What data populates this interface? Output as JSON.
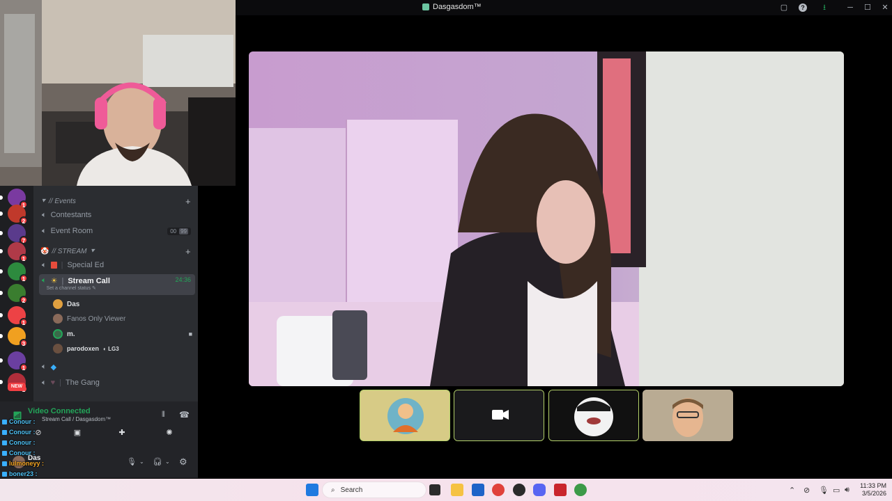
{
  "window": {
    "title": "Dasgasdom™"
  },
  "servers": [
    {
      "badge": "1",
      "color": "#7a3aa0"
    },
    {
      "badge": "2",
      "color": "#c0392b"
    },
    {
      "badge": "7",
      "color": "#5a3b8c"
    },
    {
      "badge": "1",
      "color": "#b03a48"
    },
    {
      "badge": "1",
      "color": "#2d8a3e"
    },
    {
      "badge": "2",
      "color": "#3a7d2f"
    },
    {
      "badge": "1",
      "color": "#ed4245"
    },
    {
      "badge": "3",
      "color": "#f0a020"
    },
    {
      "badge": "1",
      "color": "#6b3fa0"
    },
    {
      "badge": "1",
      "color": "#b02e3a"
    },
    {
      "badge": "NEW",
      "color": "#2b2d31"
    }
  ],
  "channels": {
    "category_events": "// Events",
    "contestants": "Contestants",
    "event_room": "Event Room",
    "event_room_count_a": "00",
    "event_room_count_b": "99",
    "category_stream": "// STREAM",
    "special_ed": "Special Ed",
    "stream_call": "Stream Call",
    "stream_call_timer": "24:36",
    "stream_call_status": "Set a channel status",
    "users": [
      {
        "name": "Das",
        "color": "#e0a040"
      },
      {
        "name": "Fanos Only Viewer",
        "color": "#8a6a5a"
      },
      {
        "name": "m.",
        "color": "#3a6a4a"
      },
      {
        "name": "parodoxen",
        "tag": "LG3",
        "color": "#6a5040"
      }
    ],
    "the_gang": "The Gang"
  },
  "voice_panel": {
    "status": "Video Connected",
    "location": "Stream Call / Dasgasdom™",
    "username": "Das"
  },
  "chat": [
    {
      "name": "Conour :",
      "color": "#4fc3f7"
    },
    {
      "name": "Conour :",
      "color": "#4fc3f7"
    },
    {
      "name": "Conour :",
      "color": "#4fc3f7"
    },
    {
      "name": "Conour :",
      "color": "#4fc3f7"
    },
    {
      "name": "lulmoneyy :",
      "color": "#f5a623"
    },
    {
      "name": "boner23 :",
      "color": "#4fc3f7"
    },
    {
      "name": "boner23 :",
      "color": "#4fc3f7"
    },
    {
      "name": "lulmoneyy :",
      "color": "#f5a623"
    }
  ],
  "taskbar": {
    "search_placeholder": "Search",
    "time": "11:33 PM",
    "date": "3/5/2026"
  },
  "colors": {
    "accent_green": "#23a559",
    "tile_border": "#b4d26a"
  }
}
